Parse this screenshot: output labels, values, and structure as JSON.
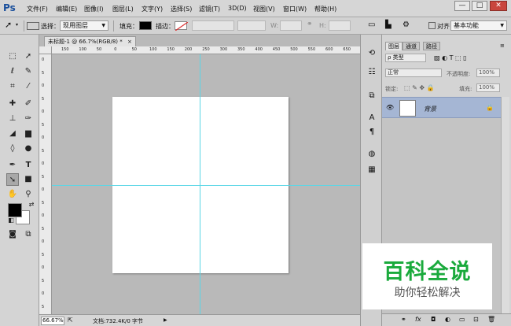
{
  "app": {
    "logo": "Ps"
  },
  "menu": [
    "文件(F)",
    "编辑(E)",
    "图像(I)",
    "图层(L)",
    "文字(Y)",
    "选择(S)",
    "滤镜(T)",
    "3D(D)",
    "视图(V)",
    "窗口(W)",
    "帮助(H)"
  ],
  "window_controls": {
    "minimize": "—",
    "restore": "□",
    "close": "✕"
  },
  "options_bar": {
    "select_label": "选择：",
    "select_value": "现用图层",
    "fill_label": "填充：",
    "stroke_label": "描边：",
    "w_label": "W:",
    "h_label": "H:",
    "align_label": "对齐",
    "workspace_value": "基本功能",
    "fill_color": "#000000"
  },
  "document": {
    "tab_label": "未标题-1 @ 66.7%(RGB/8) *",
    "ruler_h_ticks": [
      "150",
      "100",
      "50",
      "0",
      "50",
      "100",
      "150",
      "200",
      "250",
      "300",
      "350",
      "400",
      "450",
      "500",
      "550",
      "600",
      "650"
    ],
    "ruler_v_ticks": [
      "0",
      "5",
      "0",
      "5",
      "0",
      "5",
      "0",
      "5",
      "0",
      "5",
      "0",
      "5",
      "0",
      "5",
      "0",
      "5",
      "0",
      "5",
      "0",
      "5"
    ],
    "zoom": "66.67%",
    "doc_info": "文档:732.4K/0 字节"
  },
  "layers_panel": {
    "tabs": [
      "图层",
      "通道",
      "路径"
    ],
    "filter_label": "ρ 类型",
    "blend_mode": "正常",
    "opacity_label": "不透明度:",
    "opacity_value": "100%",
    "lock_label": "锁定:",
    "fill_label": "填充:",
    "fill_value": "100%",
    "layer_name": "背景",
    "selected_color": "#a5b6d4"
  },
  "watermark": {
    "main": "百科全说",
    "sub": "助你轻松解决",
    "main_color": "#1aaa3c"
  }
}
